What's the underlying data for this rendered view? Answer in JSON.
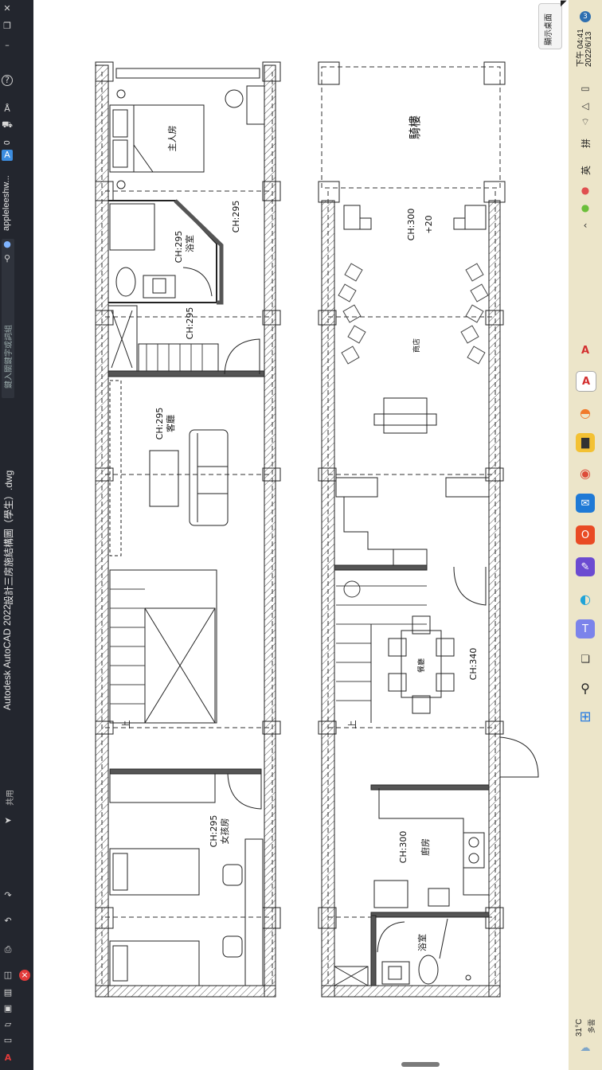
{
  "window": {
    "app_title": "Autodesk AutoCAD 2022",
    "file_title": "設計三房施結構圖（學生）.dwg",
    "search_placeholder": "鍵入關鍵字或詞組",
    "user_name": "appleleeshw...",
    "notification_count": "0",
    "share_label": "共用"
  },
  "plan": {
    "upper": {
      "master_bedroom": "主人房",
      "bath_ch": "CH:295",
      "bath": "浴室",
      "corridor_ch": "CH:295",
      "closet_ch": "CH:295",
      "living_ch": "CH:295",
      "living": "客廳",
      "stair_up": "上",
      "girl_ch": "CH:295",
      "girl_room": "女孩房"
    },
    "lower": {
      "arcade": "騎樓",
      "front_ch": "CH:300",
      "front_level": "+20",
      "store": "商店",
      "dining": "餐廳",
      "dining_ch": "CH:340",
      "stair_up": "上",
      "kitchen_ch": "CH:300",
      "kitchen": "廚房",
      "bath": "浴室"
    }
  },
  "taskbar": {
    "show_desktop": "顯示桌面",
    "time": "下午 04:41",
    "date": "2022/6/13",
    "notification_badge": "3",
    "ime_mode": "拼",
    "ime_lang": "英",
    "weather_temp": "31°C",
    "weather_desc": "多雲"
  },
  "colors": {
    "title_bg": "#23262e",
    "taskbar_bg": "#ece5c9",
    "wall_fill": "#444444",
    "accent_blue": "#3c8de0"
  }
}
